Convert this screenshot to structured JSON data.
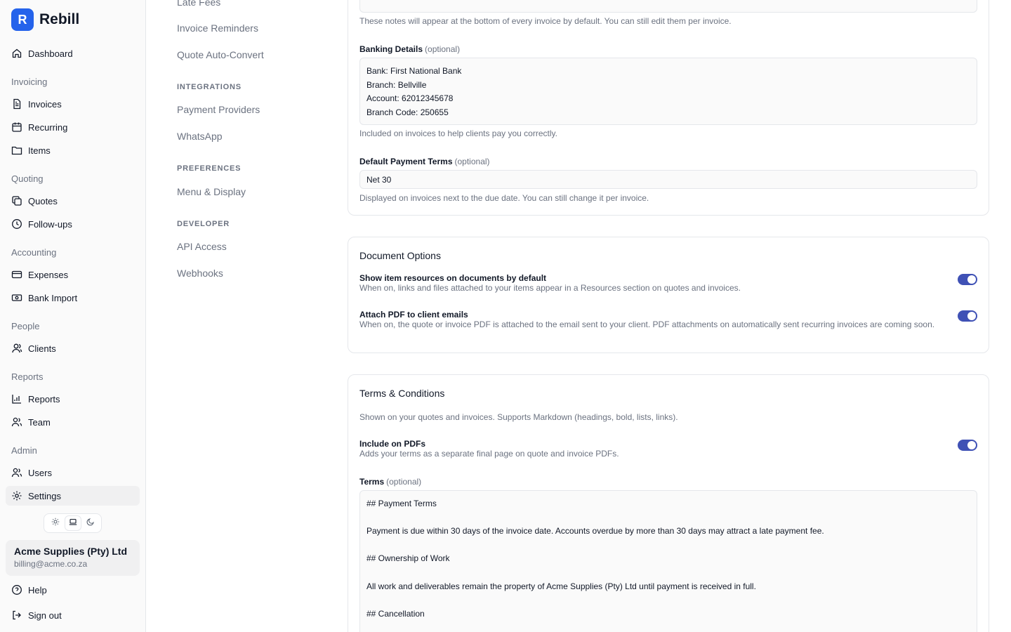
{
  "brand": {
    "logo_letter": "R",
    "name": "Rebill"
  },
  "sidebar": {
    "dashboard": "Dashboard",
    "groups": {
      "invoicing": "Invoicing",
      "quoting": "Quoting",
      "accounting": "Accounting",
      "people": "People",
      "reports": "Reports",
      "admin": "Admin"
    },
    "items": {
      "invoices": "Invoices",
      "recurring": "Recurring",
      "items": "Items",
      "quotes": "Quotes",
      "followups": "Follow-ups",
      "expenses": "Expenses",
      "bank_import": "Bank Import",
      "clients": "Clients",
      "reports": "Reports",
      "team": "Team",
      "users": "Users",
      "settings": "Settings"
    },
    "active": "Settings",
    "theme_options": [
      "light",
      "system",
      "dark"
    ],
    "theme_selected": "system",
    "account": {
      "name": "Acme Supplies (Pty) Ltd",
      "email": "billing@acme.co.za"
    },
    "help": "Help",
    "sign_out": "Sign out"
  },
  "settings_nav": {
    "late_fees": "Late Fees",
    "invoice_reminders": "Invoice Reminders",
    "quote_auto_convert": "Quote Auto-Convert",
    "integrations_heading": "INTEGRATIONS",
    "payment_providers": "Payment Providers",
    "whatsapp": "WhatsApp",
    "preferences_heading": "PREFERENCES",
    "menu_display": "Menu & Display",
    "developer_heading": "DEVELOPER",
    "api_access": "API Access",
    "webhooks": "Webhooks"
  },
  "invoice_defaults": {
    "notes_help": "These notes will appear at the bottom of every invoice by default. You can still edit them per invoice.",
    "banking_label": "Banking Details",
    "banking_optional": "(optional)",
    "banking_value": "Bank: First National Bank\nBranch: Bellville\nAccount: 62012345678\nBranch Code: 250655",
    "banking_help": "Included on invoices to help clients pay you correctly.",
    "terms_label": "Default Payment Terms",
    "terms_optional": "(optional)",
    "terms_value": "Net 30",
    "terms_help": "Displayed on invoices next to the due date. You can still change it per invoice."
  },
  "document_options": {
    "title": "Document Options",
    "show_resources_title": "Show item resources on documents by default",
    "show_resources_desc": "When on, links and files attached to your items appear in a Resources section on quotes and invoices.",
    "show_resources_on": true,
    "attach_pdf_title": "Attach PDF to client emails",
    "attach_pdf_desc": "When on, the quote or invoice PDF is attached to the email sent to your client. PDF attachments on automatically sent recurring invoices are coming soon.",
    "attach_pdf_on": true
  },
  "terms_conditions": {
    "title": "Terms & Conditions",
    "subtitle": "Shown on your quotes and invoices. Supports Markdown (headings, bold, lists, links).",
    "include_title": "Include on PDFs",
    "include_desc": "Adds your terms as a separate final page on quote and invoice PDFs.",
    "include_on": true,
    "terms_label": "Terms",
    "terms_optional": "(optional)",
    "terms_value": "## Payment Terms\n\nPayment is due within 30 days of the invoice date. Accounts overdue by more than 30 days may attract a late payment fee.\n\n## Ownership of Work\n\nAll work and deliverables remain the property of Acme Supplies (Pty) Ltd until payment is received in full.\n\n## Cancellation"
  },
  "colors": {
    "accent": "#2563eb",
    "toggle_on": "#3f51b5"
  }
}
